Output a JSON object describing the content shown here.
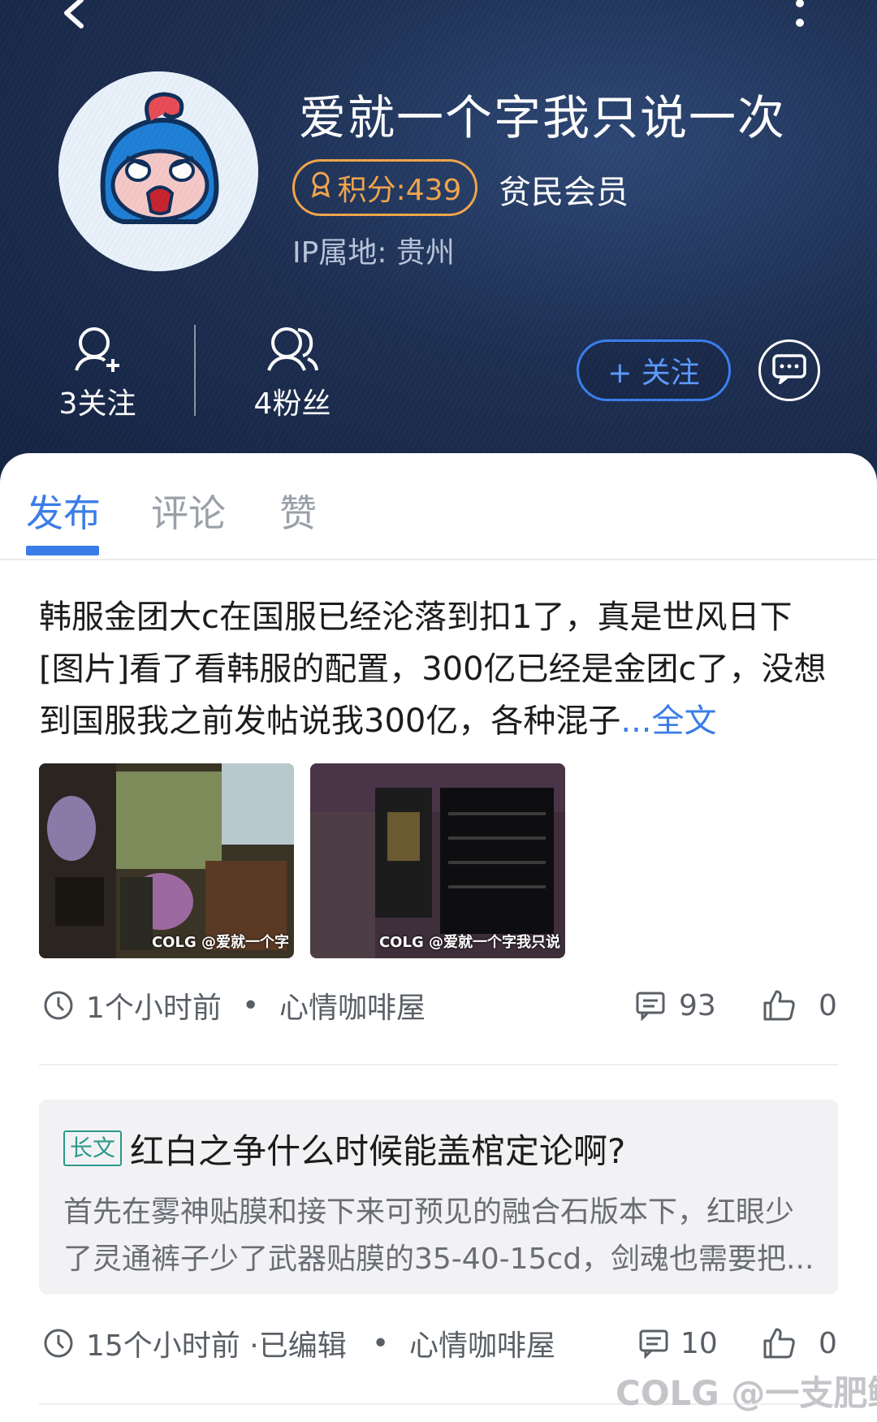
{
  "profile": {
    "username": "爱就一个字我只说一次",
    "points_label": "积分:439",
    "member_level": "贫民会员",
    "ip_location": "IP属地: 贵州",
    "following_label": "3关注",
    "followers_label": "4粉丝",
    "follow_button_label": "+ 关注"
  },
  "tabs": [
    {
      "label": "发布",
      "active": true
    },
    {
      "label": "评论",
      "active": false
    },
    {
      "label": "赞",
      "active": false
    }
  ],
  "posts": [
    {
      "text": "韩服金团大c在国服已经沦落到扣1了，真是世风日下[图片]看了看韩服的配置，300亿已经是金团c了，没想到国服我之前发帖说我300亿，各种混子",
      "expand_label": "...全文",
      "images": [
        {
          "watermark": "COLG @爱就一个字"
        },
        {
          "watermark": "COLG @爱就一个字我只说"
        }
      ],
      "time": "1个小时前",
      "board": "心情咖啡屋",
      "comments": "93",
      "likes": "0"
    },
    {
      "tag": "长文",
      "title": "红白之争什么时候能盖棺定论啊?",
      "excerpt": "首先在雾神贴膜和接下来可预见的融合石版本下，红眼少了灵通裤子少了武器贴膜的35-40-15cd，剑魂也需要把...",
      "time": "15个小时前 ·已编辑",
      "board": "心情咖啡屋",
      "comments": "10",
      "likes": "0"
    }
  ],
  "watermark": "COLG @一支肥鲸",
  "colors": {
    "header_bg": "#1d2f52",
    "accent_blue": "#3b7de8",
    "badge_orange": "#f2a54a",
    "tag_teal": "#2b9a8a"
  }
}
